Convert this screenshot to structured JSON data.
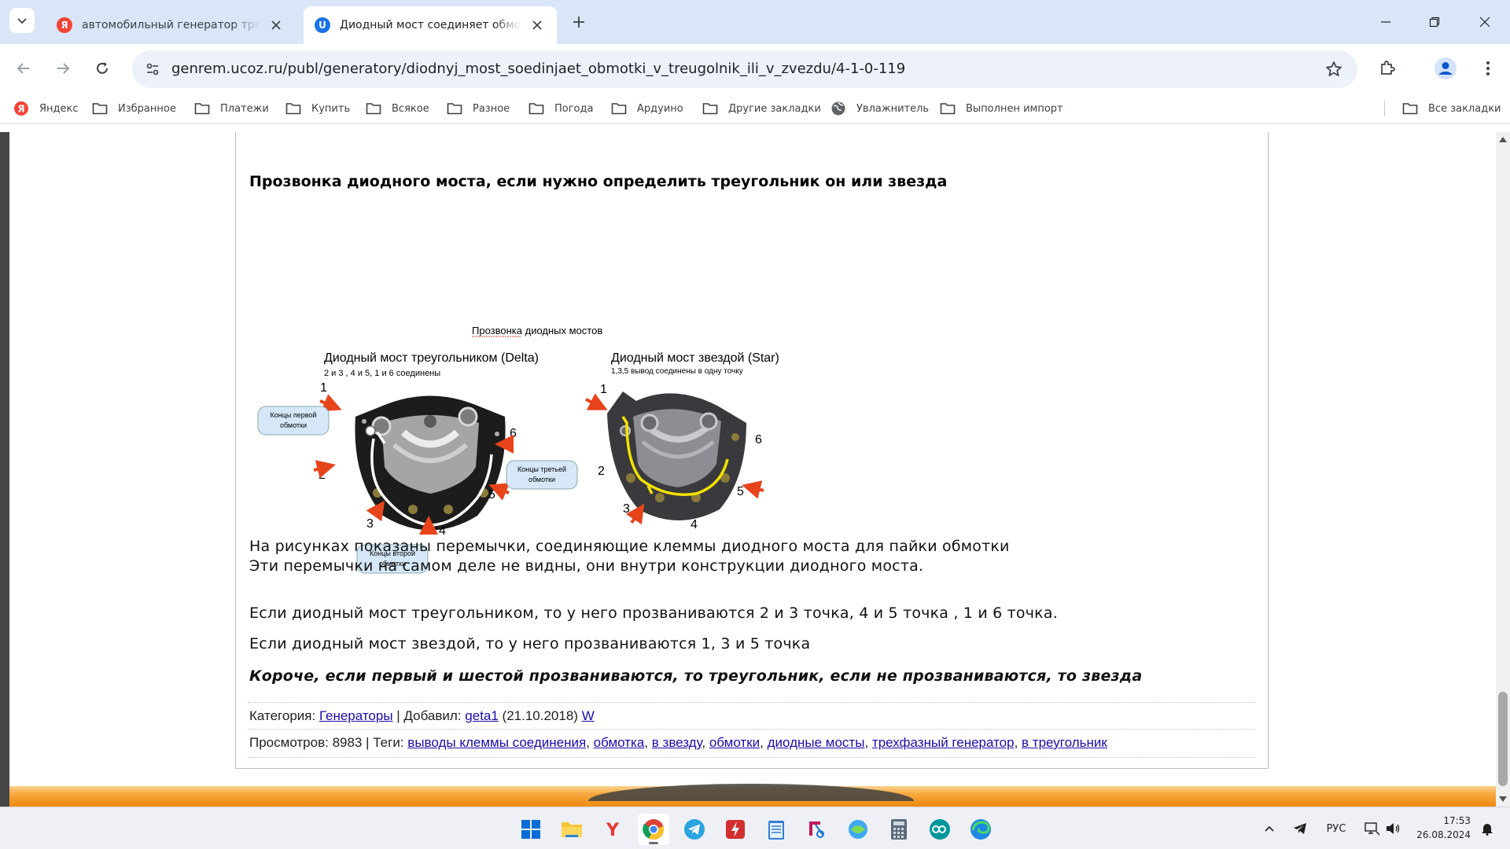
{
  "browser": {
    "tabs": [
      {
        "title": "автомобильный генератор треугольник",
        "favicon": "yandex-icon"
      },
      {
        "title": "Диодный мост соединяет обмотки в треугольник",
        "favicon": "ucoz-icon"
      }
    ],
    "url": "genrem.ucoz.ru/publ/generatory/diodnyj_most_soedinjaet_obmotki_v_treugolnik_ili_v_zvezdu/4-1-0-119",
    "bookmarks": [
      {
        "label": "Яндекс",
        "icon": "yandex-icon"
      },
      {
        "label": "Избранное",
        "icon": "folder-icon"
      },
      {
        "label": "Платежи",
        "icon": "folder-icon"
      },
      {
        "label": "Купить",
        "icon": "folder-icon"
      },
      {
        "label": "Всякое",
        "icon": "folder-icon"
      },
      {
        "label": "Разное",
        "icon": "folder-icon"
      },
      {
        "label": "Погода",
        "icon": "folder-icon"
      },
      {
        "label": "Ардуино",
        "icon": "folder-icon"
      },
      {
        "label": "Другие закладки",
        "icon": "folder-icon"
      },
      {
        "label": "Увлажнитель",
        "icon": "globe-icon"
      },
      {
        "label": "Выполнен импорт",
        "icon": "folder-icon"
      }
    ],
    "all_bookmarks": "Все закладки"
  },
  "article": {
    "heading": "Прозвонка диодного моста, если нужно определить треугольник он или звезда",
    "figure": {
      "title": "Прозвонка диодных мостов",
      "delta": {
        "caption": "Диодный мост треугольником (Delta)",
        "sub": "2 и 3 ,  4 и 5,  1 и 6 соединены",
        "callout1": [
          "Концы первой",
          "обмотки"
        ],
        "callout2": [
          "Концы второй",
          "обмотки"
        ],
        "callout3": [
          "Концы третьей",
          "обмотки"
        ],
        "numbers": [
          "1",
          "2",
          "3",
          "4",
          "5",
          "6"
        ]
      },
      "star": {
        "caption": "Диодный мост звездой (Star)",
        "sub": "1,3,5 вывод соединены в одну точку",
        "numbers": [
          "1",
          "2",
          "3",
          "4",
          "5",
          "6"
        ]
      }
    },
    "para1": "На рисунках показаны перемычки, соединяющие клеммы диодного моста для пайки обмотки",
    "para2": "Эти перемычки на самом деле не видны, они внутри конструкции диодного моста.",
    "para3": "Если диодный мост треугольником, то у него прозваниваются  2 и  3 точка, 4 и 5 точка , 1 и 6 точка.",
    "para4": "Если диодный мост звездой, то у него прозваниваются 1, 3 и 5 точка",
    "para5": "Короче, если первый и шестой прозваниваются, то треугольник, если не прозваниваются, то звезда"
  },
  "meta": {
    "category_label": "Категория:",
    "category": "Генераторы",
    "sep1": " | Добавил: ",
    "author": "geta1",
    "date": " (21.10.2018) ",
    "w": "W",
    "views": "Просмотров: 8983 | Теги: ",
    "tags": [
      "выводы клеммы соединения",
      "обмотка",
      "в звезду",
      "обмотки",
      "диодные мосты",
      "трехфазный генератор",
      "в треугольник"
    ]
  },
  "taskbar": {
    "apps": [
      "windows-start-icon",
      "file-explorer-icon",
      "yandex-browser-icon",
      "chrome-icon",
      "telegram-icon",
      "flash-app-icon",
      "notepad-icon",
      "snipping-tool-icon",
      "network-app-icon",
      "calculator-icon",
      "arduino-icon",
      "edge-icon"
    ],
    "lang": "РУС",
    "time": "17:53",
    "date": "26.08.2024"
  },
  "colors": {
    "accent_blue": "#1a73e8",
    "tab_bg": "#dae6f8",
    "arrow_red": "#e8441c",
    "star_wire": "#f4e200"
  }
}
